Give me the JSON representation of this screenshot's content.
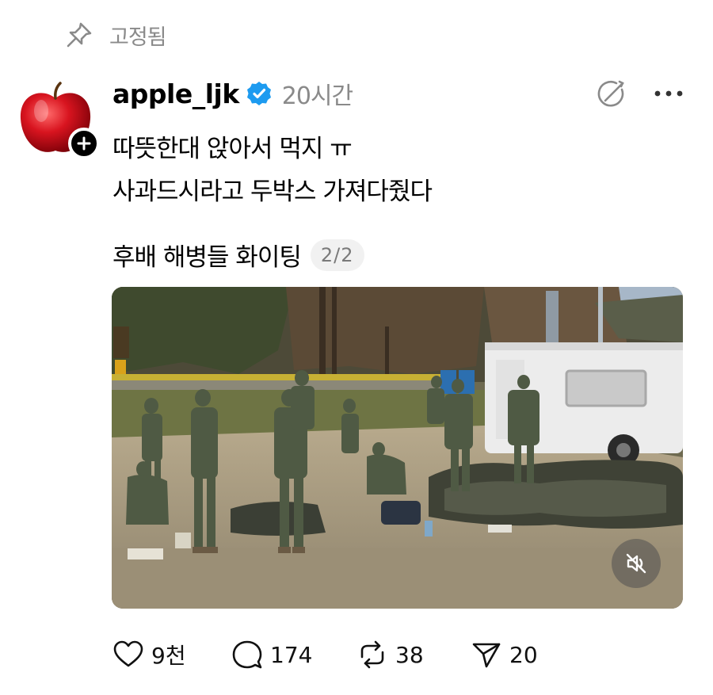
{
  "pinned": {
    "label": "고정됨",
    "icon": "pin-icon"
  },
  "post": {
    "username": "apple_ljk",
    "verified": true,
    "time": "20시간",
    "lines": [
      "따뜻한대 앉아서 먹지 ㅠ",
      "사과드시라고 두박스 가져다줬다",
      "후배 해병들 화이팅"
    ],
    "page_counter": "2/2"
  },
  "icons": {
    "verified": "verified-badge-icon",
    "ai": "ai-slash-icon",
    "more": "more-dots-icon",
    "mute": "speaker-muted-icon"
  },
  "actions": {
    "like_count": "9천",
    "reply_count": "174",
    "repost_count": "38",
    "share_count": "20"
  },
  "colors": {
    "verified_blue": "#1d9bf0",
    "secondary_text": "#8a8a8a",
    "apple_red": "#c8101c"
  }
}
